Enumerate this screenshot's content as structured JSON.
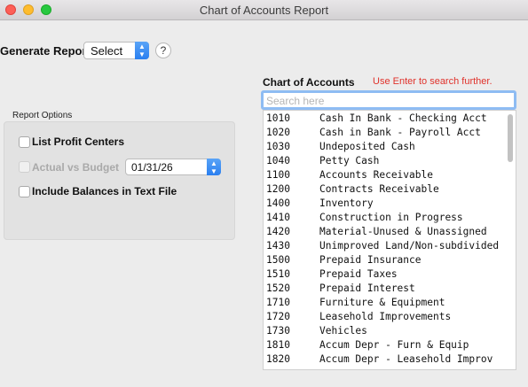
{
  "window": {
    "title": "Chart of Accounts Report"
  },
  "generate": {
    "label": "Generate Report",
    "value": "Select",
    "help": "?"
  },
  "options": {
    "title": "Report Options",
    "list_profit_centers": "List Profit Centers",
    "actual_vs_budget": "Actual vs Budget",
    "date": "01/31/26",
    "include_balances": "Include Balances in Text File"
  },
  "coa": {
    "title": "Chart of Accounts",
    "hint": "Use Enter to search further.",
    "search_placeholder": "Search here",
    "accounts": [
      {
        "code": "1010",
        "name": "Cash In Bank - Checking Acct"
      },
      {
        "code": "1020",
        "name": "Cash in Bank - Payroll Acct"
      },
      {
        "code": "1030",
        "name": "Undeposited Cash"
      },
      {
        "code": "1040",
        "name": "Petty Cash"
      },
      {
        "code": "1100",
        "name": "Accounts Receivable"
      },
      {
        "code": "1200",
        "name": "Contracts Receivable"
      },
      {
        "code": "1400",
        "name": "Inventory"
      },
      {
        "code": "1410",
        "name": "Construction in Progress"
      },
      {
        "code": "1420",
        "name": "Material-Unused & Unassigned"
      },
      {
        "code": "1430",
        "name": "Unimproved Land/Non-subdivided"
      },
      {
        "code": "1500",
        "name": "Prepaid Insurance"
      },
      {
        "code": "1510",
        "name": "Prepaid Taxes"
      },
      {
        "code": "1520",
        "name": "Prepaid Interest"
      },
      {
        "code": "1710",
        "name": "Furniture & Equipment"
      },
      {
        "code": "1720",
        "name": "Leasehold Improvements"
      },
      {
        "code": "1730",
        "name": "Vehicles"
      },
      {
        "code": "1810",
        "name": "Accum Depr - Furn & Equip"
      },
      {
        "code": "1820",
        "name": "Accum Depr - Leasehold Improv"
      }
    ]
  }
}
